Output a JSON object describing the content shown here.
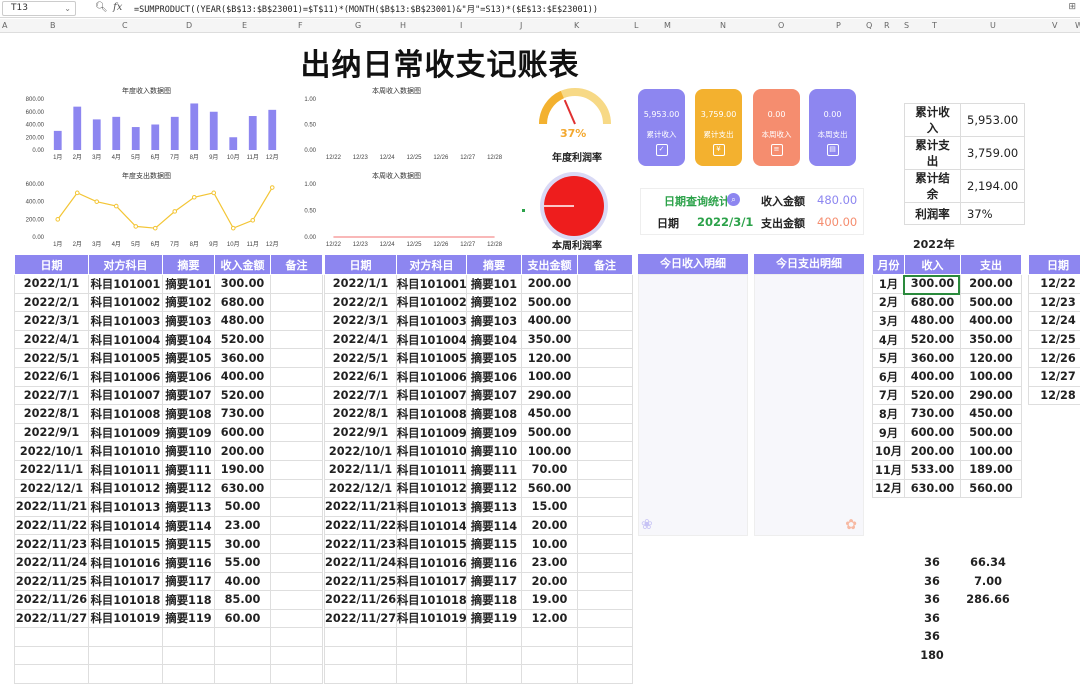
{
  "formula_bar": {
    "cell": "T13",
    "fx": "fx",
    "formula": "=SUMPRODUCT((YEAR($B$13:$B$23001)=$T$11)*(MONTH($B$13:$B$23001)&\"月\"=S13)*($E$13:$E$23001))"
  },
  "columns": [
    "A",
    "B",
    "C",
    "D",
    "E",
    "F",
    "G",
    "H",
    "I",
    "J",
    "K",
    "L",
    "M",
    "N",
    "O",
    "P",
    "Q",
    "R",
    "S",
    "T",
    "U",
    "V",
    "W"
  ],
  "title": "出纳日常收支记账表",
  "charts": {
    "annual_income": {
      "title": "年度收入数据图",
      "yticks": [
        "800.00",
        "600.00",
        "400.00",
        "200.00",
        "0.00"
      ]
    },
    "annual_expense": {
      "title": "年度支出数据图",
      "yticks": [
        "600.00",
        "400.00",
        "200.00",
        "0.00"
      ]
    },
    "week_income_1": {
      "title": "本周收入数据图",
      "yticks": [
        "1.00",
        "0.50",
        "0.00"
      ]
    },
    "week_income_2": {
      "title": "本周收入数据图",
      "yticks": [
        "1.00",
        "0.50",
        "0.00"
      ]
    },
    "week_days": [
      "12/22",
      "12/23",
      "12/24",
      "12/25",
      "12/26",
      "12/27",
      "12/28"
    ]
  },
  "chart_data": [
    {
      "type": "bar",
      "title": "年度收入数据图",
      "categories": [
        "1月",
        "2月",
        "3月",
        "4月",
        "5月",
        "6月",
        "7月",
        "8月",
        "9月",
        "10月",
        "11月",
        "12月"
      ],
      "values": [
        300,
        680,
        480,
        520,
        360,
        400,
        520,
        730,
        600,
        200,
        533,
        630
      ],
      "ylim": [
        0,
        800
      ]
    },
    {
      "type": "line",
      "title": "年度支出数据图",
      "categories": [
        "1月",
        "2月",
        "3月",
        "4月",
        "5月",
        "6月",
        "7月",
        "8月",
        "9月",
        "10月",
        "11月",
        "12月"
      ],
      "values": [
        200,
        500,
        400,
        350,
        120,
        100,
        290,
        450,
        500,
        100,
        189,
        560
      ],
      "ylim": [
        0,
        600
      ]
    },
    {
      "type": "bar",
      "title": "本周收入数据图",
      "categories": [
        "12/22",
        "12/23",
        "12/24",
        "12/25",
        "12/26",
        "12/27",
        "12/28"
      ],
      "values": [
        0,
        0,
        0,
        0,
        0,
        0,
        0
      ],
      "ylim": [
        0,
        1
      ]
    },
    {
      "type": "line",
      "title": "本周收入数据图",
      "categories": [
        "12/22",
        "12/23",
        "12/24",
        "12/25",
        "12/26",
        "12/27",
        "12/28"
      ],
      "values": [
        0,
        0,
        0,
        0,
        0,
        0,
        0
      ],
      "ylim": [
        0,
        1
      ]
    }
  ],
  "gauges": {
    "annual": {
      "pct_label": "37%",
      "value": 0.37,
      "label": "年度利润率"
    },
    "weekly": {
      "label": "本周利润率"
    }
  },
  "kpis": [
    {
      "value": "5,953.00",
      "label": "累计收入",
      "color": "#8d86f0"
    },
    {
      "value": "3,759.00",
      "label": "累计支出",
      "color": "#f3b12f"
    },
    {
      "value": "0.00",
      "label": "本周收入",
      "color": "#f58d6f"
    },
    {
      "value": "0.00",
      "label": "本周支出",
      "color": "#8d86f0"
    }
  ],
  "summary": [
    {
      "k": "累计收入",
      "v": "5,953.00"
    },
    {
      "k": "累计支出",
      "v": "3,759.00"
    },
    {
      "k": "累计结余",
      "v": "2,194.00"
    },
    {
      "k": "利润率",
      "v": "37%"
    }
  ],
  "date_query": {
    "title": "日期查询统计",
    "date_label": "日期",
    "date_value": "2022/3/1",
    "income_label": "收入金额",
    "income_value": "480.00",
    "expense_label": "支出金额",
    "expense_value": "400.00"
  },
  "year_label": "2022年",
  "income_table": {
    "headers": [
      "日期",
      "对方科目",
      "摘要",
      "收入金额",
      "备注"
    ],
    "rows": [
      [
        "2022/1/1",
        "科目101001",
        "摘要101",
        "300.00"
      ],
      [
        "2022/2/1",
        "科目101002",
        "摘要102",
        "680.00"
      ],
      [
        "2022/3/1",
        "科目101003",
        "摘要103",
        "480.00"
      ],
      [
        "2022/4/1",
        "科目101004",
        "摘要104",
        "520.00"
      ],
      [
        "2022/5/1",
        "科目101005",
        "摘要105",
        "360.00"
      ],
      [
        "2022/6/1",
        "科目101006",
        "摘要106",
        "400.00"
      ],
      [
        "2022/7/1",
        "科目101007",
        "摘要107",
        "520.00"
      ],
      [
        "2022/8/1",
        "科目101008",
        "摘要108",
        "730.00"
      ],
      [
        "2022/9/1",
        "科目101009",
        "摘要109",
        "600.00"
      ],
      [
        "2022/10/1",
        "科目101010",
        "摘要110",
        "200.00"
      ],
      [
        "2022/11/1",
        "科目101011",
        "摘要111",
        "190.00"
      ],
      [
        "2022/12/1",
        "科目101012",
        "摘要112",
        "630.00"
      ],
      [
        "2022/11/21",
        "科目101013",
        "摘要113",
        "50.00"
      ],
      [
        "2022/11/22",
        "科目101014",
        "摘要114",
        "23.00"
      ],
      [
        "2022/11/23",
        "科目101015",
        "摘要115",
        "30.00"
      ],
      [
        "2022/11/24",
        "科目101016",
        "摘要116",
        "55.00"
      ],
      [
        "2022/11/25",
        "科目101017",
        "摘要117",
        "40.00"
      ],
      [
        "2022/11/26",
        "科目101018",
        "摘要118",
        "85.00"
      ],
      [
        "2022/11/27",
        "科目101019",
        "摘要119",
        "60.00"
      ]
    ]
  },
  "expense_table": {
    "headers": [
      "日期",
      "对方科目",
      "摘要",
      "支出金额",
      "备注"
    ],
    "rows": [
      [
        "2022/1/1",
        "科目101001",
        "摘要101",
        "200.00"
      ],
      [
        "2022/2/1",
        "科目101002",
        "摘要102",
        "500.00"
      ],
      [
        "2022/3/1",
        "科目101003",
        "摘要103",
        "400.00"
      ],
      [
        "2022/4/1",
        "科目101004",
        "摘要104",
        "350.00"
      ],
      [
        "2022/5/1",
        "科目101005",
        "摘要105",
        "120.00"
      ],
      [
        "2022/6/1",
        "科目101006",
        "摘要106",
        "100.00"
      ],
      [
        "2022/7/1",
        "科目101007",
        "摘要107",
        "290.00"
      ],
      [
        "2022/8/1",
        "科目101008",
        "摘要108",
        "450.00"
      ],
      [
        "2022/9/1",
        "科目101009",
        "摘要109",
        "500.00"
      ],
      [
        "2022/10/1",
        "科目101010",
        "摘要110",
        "100.00"
      ],
      [
        "2022/11/1",
        "科目101011",
        "摘要111",
        "70.00"
      ],
      [
        "2022/12/1",
        "科目101012",
        "摘要112",
        "560.00"
      ],
      [
        "2022/11/21",
        "科目101013",
        "摘要113",
        "15.00"
      ],
      [
        "2022/11/22",
        "科目101014",
        "摘要114",
        "20.00"
      ],
      [
        "2022/11/23",
        "科目101015",
        "摘要115",
        "10.00"
      ],
      [
        "2022/11/24",
        "科目101016",
        "摘要116",
        "23.00"
      ],
      [
        "2022/11/25",
        "科目101017",
        "摘要117",
        "20.00"
      ],
      [
        "2022/11/26",
        "科目101018",
        "摘要118",
        "19.00"
      ],
      [
        "2022/11/27",
        "科目101019",
        "摘要119",
        "12.00"
      ]
    ]
  },
  "today": {
    "income_title": "今日收入明细",
    "expense_title": "今日支出明细"
  },
  "monthly": {
    "headers": [
      "月份",
      "收入",
      "支出"
    ],
    "rows": [
      [
        "1月",
        "300.00",
        "200.00"
      ],
      [
        "2月",
        "680.00",
        "500.00"
      ],
      [
        "3月",
        "480.00",
        "400.00"
      ],
      [
        "4月",
        "520.00",
        "350.00"
      ],
      [
        "5月",
        "360.00",
        "120.00"
      ],
      [
        "6月",
        "400.00",
        "100.00"
      ],
      [
        "7月",
        "520.00",
        "290.00"
      ],
      [
        "8月",
        "730.00",
        "450.00"
      ],
      [
        "9月",
        "600.00",
        "500.00"
      ],
      [
        "10月",
        "200.00",
        "100.00"
      ],
      [
        "11月",
        "533.00",
        "189.00"
      ],
      [
        "12月",
        "630.00",
        "560.00"
      ]
    ]
  },
  "extra_cells": [
    [
      "36",
      "66.34"
    ],
    [
      "36",
      "7.00"
    ],
    [
      "36",
      "286.66"
    ],
    [
      "36",
      ""
    ],
    [
      "36",
      ""
    ],
    [
      "180",
      ""
    ]
  ],
  "week_table": {
    "header": "日期",
    "rows": [
      "12/22",
      "12/23",
      "12/24",
      "12/25",
      "12/26",
      "12/27",
      "12/28"
    ]
  }
}
